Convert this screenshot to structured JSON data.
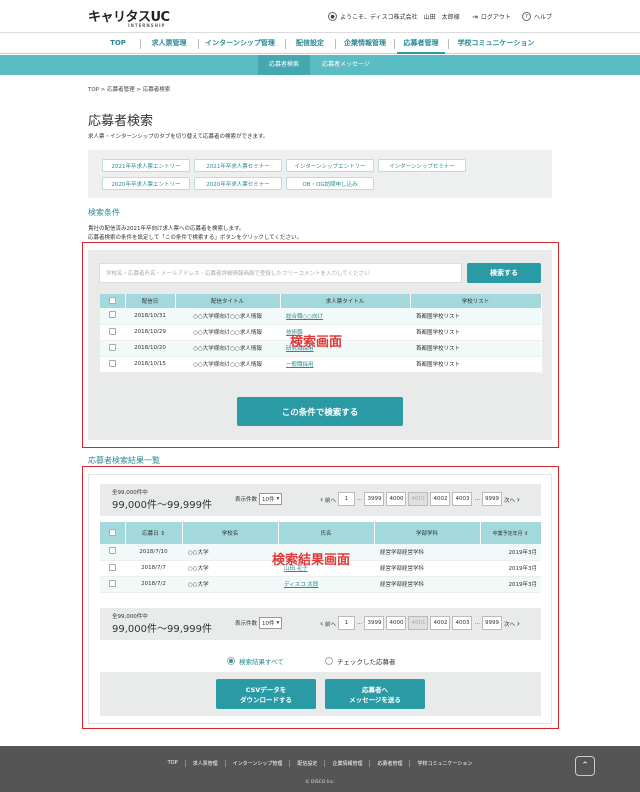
{
  "header": {
    "logo": "キャリタスUC",
    "logo_sub": "INTERNSHIP",
    "user_text": "ようこそ、ディスコ株式会社　山田　太郎様",
    "logout": "ログアウト",
    "help": "ヘルプ"
  },
  "nav": [
    "TOP",
    "求人票管理",
    "インターンシップ管理",
    "配信設定",
    "企業情報管理",
    "応募者管理",
    "学校コミュニケーション"
  ],
  "subnav": [
    "応募者検索",
    "応募者メッセージ"
  ],
  "breadcrumb": "TOP > 応募者管理 > 応募者検索",
  "page_title": "応募者検索",
  "page_desc": "求人票・インターンシップのタブを切り替えて応募者の検索ができます。",
  "tabs": [
    "2021年卒求人票エントリー",
    "2021年卒求人票セミナー",
    "インターンシップエントリー",
    "インターンシップセミナー",
    "2020年卒求人票エントリー",
    "2020年卒求人票セミナー",
    "OB・OG訪問申し込み"
  ],
  "conditions": {
    "title": "検索条件",
    "note1": "貴社の配信済み2021年卒向け求人票への応募者を検索します。",
    "note2": "応募者検索の条件を設定して「この条件で検索する」ボタンをクリックしてください。",
    "search_placeholder": "学校名・応募者氏名・メールアドレス・応募者詳細情報画面で登録したフリーコメントを入力してください",
    "search_button": "検索する",
    "headers": [
      "配信日",
      "配信タイトル",
      "求人票タイトル",
      "学校リスト"
    ],
    "rows": [
      {
        "date": "2018/10/31",
        "title": "○○大学様向け○○求人情報",
        "job": "総合職○○向け",
        "list": "首都圏学校リスト"
      },
      {
        "date": "2018/10/29",
        "title": "○○大学様向け○○求人情報",
        "job": "技術職",
        "list": "首都圏学校リスト"
      },
      {
        "date": "2018/10/20",
        "title": "○○大学様向け○○求人情報",
        "job": "研究職採用",
        "list": "首都圏学校リスト"
      },
      {
        "date": "2018/10/15",
        "title": "○○大学様向け○○求人情報",
        "job": "一般職採用",
        "list": "首都圏学校リスト"
      }
    ],
    "overlay": "検索画面",
    "submit": "この条件で検索する"
  },
  "results": {
    "title": "応募者検索結果一覧",
    "total_label": "全99,000件中",
    "range": "99,000件～99,999件",
    "per_page_label": "表示件数",
    "per_page": "10件",
    "prev": "前へ",
    "next": "次へ",
    "pages": [
      "1",
      "…",
      "3999",
      "4000",
      "4001",
      "4002",
      "4003",
      "…",
      "9999"
    ],
    "current_page": "4001",
    "headers": [
      "応募日",
      "学校名",
      "氏名",
      "学部学科",
      "卒業予定年月"
    ],
    "rows": [
      {
        "date": "2018/7/10",
        "school": "○○大学",
        "name": "",
        "dept": "経営学部経営学科",
        "grad": "2019年3月"
      },
      {
        "date": "2018/7/7",
        "school": "○○大学",
        "name": "山田 花子",
        "dept": "経営学部経営学科",
        "grad": "2019年3月"
      },
      {
        "date": "2018/7/2",
        "school": "○○大学",
        "name": "ディスコ 太郎",
        "dept": "経営学部経営学科",
        "grad": "2019年3月"
      }
    ],
    "overlay": "検索結果画面",
    "radio_all": "検索結果すべて",
    "radio_checked": "チェックした応募者",
    "csv_button": "CSVデータを\nダウンロードする",
    "msg_button": "応募者へ\nメッセージを送る"
  },
  "footer": {
    "links": [
      "TOP",
      "求人票管理",
      "インターンシップ管理",
      "配信設定",
      "企業情報管理",
      "応募者管理",
      "学校コミュニケーション"
    ],
    "copyright": "© DISCO Inc."
  },
  "colors": {
    "accent": "#2a9aa5",
    "header_row": "#a3d8dc",
    "subnav": "#5bbdc4",
    "highlight": "#d9262b",
    "footer": "#555555"
  }
}
